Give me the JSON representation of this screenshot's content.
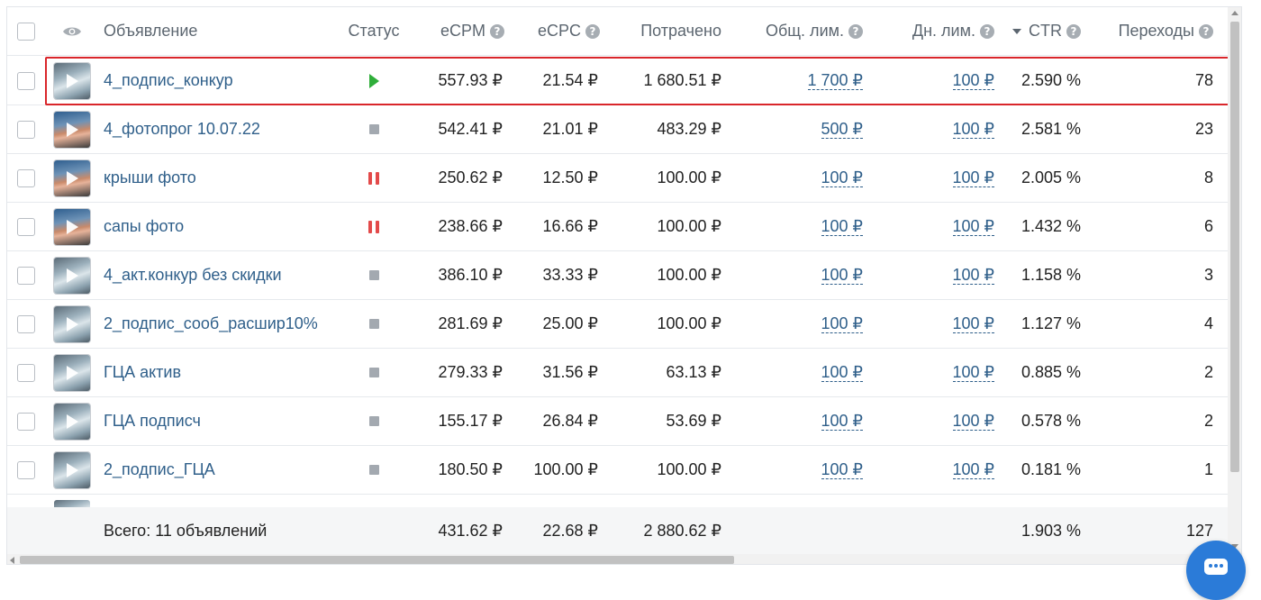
{
  "header": {
    "ad": "Объявление",
    "status": "Статус",
    "ecpm": "eCPM",
    "ecpc": "eCPC",
    "spent": "Потрачено",
    "total_limit": "Общ. лим.",
    "daily_limit": "Дн. лим.",
    "ctr": "CTR",
    "clicks": "Переходы",
    "help_glyph": "?"
  },
  "rows": [
    {
      "name": "4_подпис_конкур",
      "status": "running",
      "thumb": "boat",
      "ecpm": "557.93 ₽",
      "ecpc": "21.54 ₽",
      "spent": "1 680.51 ₽",
      "total_limit": "1 700 ₽",
      "daily_limit": "100 ₽",
      "ctr": "2.590 %",
      "clicks": "78"
    },
    {
      "name": "4_фотопрог 10.07.22",
      "status": "stopped",
      "thumb": "person",
      "ecpm": "542.41 ₽",
      "ecpc": "21.01 ₽",
      "spent": "483.29 ₽",
      "total_limit": "500 ₽",
      "daily_limit": "100 ₽",
      "ctr": "2.581 %",
      "clicks": "23"
    },
    {
      "name": "крыши фото",
      "status": "paused",
      "thumb": "person",
      "ecpm": "250.62 ₽",
      "ecpc": "12.50 ₽",
      "spent": "100.00 ₽",
      "total_limit": "100 ₽",
      "daily_limit": "100 ₽",
      "ctr": "2.005 %",
      "clicks": "8"
    },
    {
      "name": "сапы фото",
      "status": "paused",
      "thumb": "person",
      "ecpm": "238.66 ₽",
      "ecpc": "16.66 ₽",
      "spent": "100.00 ₽",
      "total_limit": "100 ₽",
      "daily_limit": "100 ₽",
      "ctr": "1.432 %",
      "clicks": "6"
    },
    {
      "name": "4_акт.конкур без скидки",
      "status": "stopped",
      "thumb": "boat",
      "ecpm": "386.10 ₽",
      "ecpc": "33.33 ₽",
      "spent": "100.00 ₽",
      "total_limit": "100 ₽",
      "daily_limit": "100 ₽",
      "ctr": "1.158 %",
      "clicks": "3"
    },
    {
      "name": "2_подпис_сооб_расшир10%",
      "status": "stopped",
      "thumb": "boat",
      "ecpm": "281.69 ₽",
      "ecpc": "25.00 ₽",
      "spent": "100.00 ₽",
      "total_limit": "100 ₽",
      "daily_limit": "100 ₽",
      "ctr": "1.127 %",
      "clicks": "4"
    },
    {
      "name": "ГЦА актив",
      "status": "stopped",
      "thumb": "boat",
      "ecpm": "279.33 ₽",
      "ecpc": "31.56 ₽",
      "spent": "63.13 ₽",
      "total_limit": "100 ₽",
      "daily_limit": "100 ₽",
      "ctr": "0.885 %",
      "clicks": "2"
    },
    {
      "name": "ГЦА подписч",
      "status": "stopped",
      "thumb": "boat",
      "ecpm": "155.17 ₽",
      "ecpc": "26.84 ₽",
      "spent": "53.69 ₽",
      "total_limit": "100 ₽",
      "daily_limit": "100 ₽",
      "ctr": "0.578 %",
      "clicks": "2"
    },
    {
      "name": "2_подпис_ГЦА",
      "status": "stopped",
      "thumb": "boat",
      "ecpm": "180.50 ₽",
      "ecpc": "100.00 ₽",
      "spent": "100.00 ₽",
      "total_limit": "100 ₽",
      "daily_limit": "100 ₽",
      "ctr": "0.181 %",
      "clicks": "1"
    }
  ],
  "totals": {
    "label": "Всего: 11 объявлений",
    "ecpm": "431.62 ₽",
    "ecpc": "22.68 ₽",
    "spent": "2 880.62 ₽",
    "ctr": "1.903 %",
    "clicks": "127"
  },
  "colors": {
    "highlight": "#d9262b",
    "running": "#2fae3a",
    "paused": "#e34a4a",
    "stopped": "#a3a9b0",
    "link": "#2f5f8a"
  }
}
